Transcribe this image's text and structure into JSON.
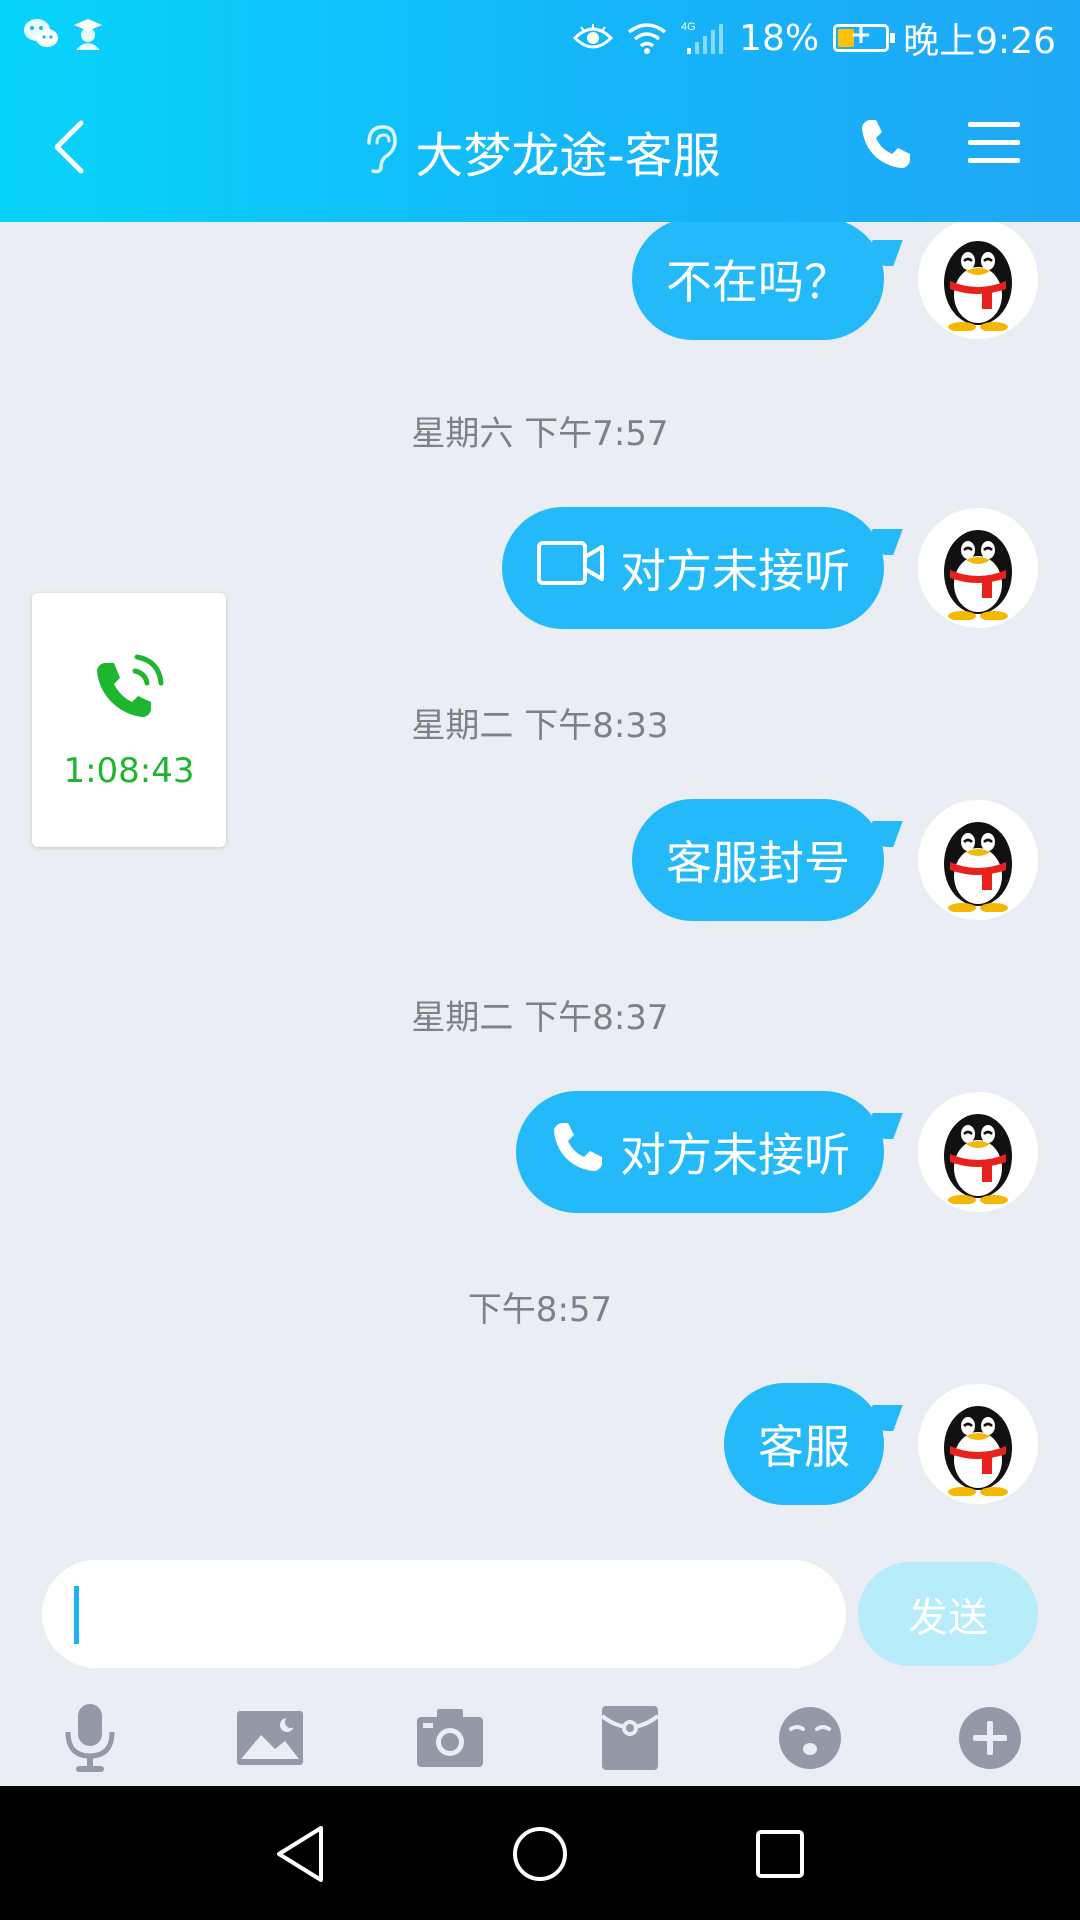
{
  "status_bar": {
    "left_icons": [
      "wechat-icon",
      "app-notification-icon"
    ],
    "network": "4G",
    "battery_percent": "18%",
    "time": "晚上9:26"
  },
  "header": {
    "title": "大梦龙途-客服",
    "left_icon": "back-icon",
    "title_icon": "ear-icon",
    "right_icons": [
      "phone-icon",
      "menu-icon"
    ]
  },
  "messages": [
    {
      "type": "text",
      "text": "不在吗？"
    },
    {
      "type": "timestamp",
      "text": "星期六 下午7:57"
    },
    {
      "type": "video-call",
      "icon": "video-camera-icon",
      "text": "对方未接听"
    },
    {
      "type": "timestamp",
      "text": "星期二 下午8:33"
    },
    {
      "type": "text",
      "text": "客服封号"
    },
    {
      "type": "timestamp",
      "text": "星期二 下午8:37"
    },
    {
      "type": "voice-call",
      "icon": "phone-icon",
      "text": "对方未接听"
    },
    {
      "type": "timestamp",
      "text": "下午8:57"
    },
    {
      "type": "text",
      "text": "客服"
    }
  ],
  "floating_call": {
    "icon": "phone-ringing-icon",
    "duration": "1:08:43"
  },
  "input": {
    "value": "",
    "placeholder": ""
  },
  "send_button": {
    "label": "发送"
  },
  "toolbar": [
    "microphone-icon",
    "image-icon",
    "camera-icon",
    "red-packet-icon",
    "emoji-icon",
    "plus-icon"
  ],
  "colors": {
    "header": "#14b6f9",
    "bubble": "#24bafa",
    "background": "#eaedf4",
    "call_green": "#1db62e"
  }
}
